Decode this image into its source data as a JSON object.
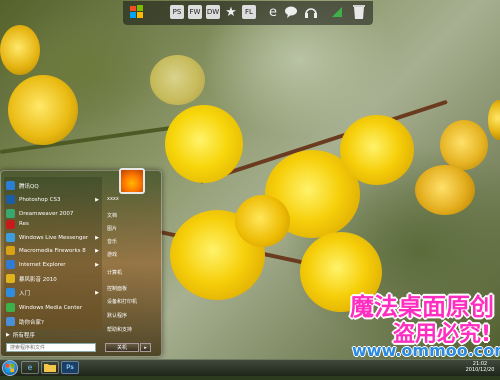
{
  "toolbar": {
    "icons": [
      {
        "name": "windows-logo-icon",
        "label": ""
      },
      {
        "name": "photoshop-icon",
        "label": "PS"
      },
      {
        "name": "fireworks-icon",
        "label": "FW"
      },
      {
        "name": "dreamweaver-icon",
        "label": "DW"
      },
      {
        "name": "star-icon",
        "label": "★"
      },
      {
        "name": "flash-icon",
        "label": "FL"
      },
      {
        "name": "ie-icon",
        "label": "e"
      },
      {
        "name": "chat-icon",
        "label": ""
      },
      {
        "name": "headphones-icon",
        "label": ""
      },
      {
        "name": "signal-icon",
        "label": ""
      },
      {
        "name": "recycle-bin-icon",
        "label": ""
      }
    ]
  },
  "start_menu": {
    "programs": [
      {
        "label": "腾讯QQ",
        "color": "#2a7fd4"
      },
      {
        "label": "Photoshop CS3",
        "color": "#1b5ea8"
      },
      {
        "label": "Dreamweaver 2007",
        "color": "#3aa86e"
      },
      {
        "label": "Res",
        "color": "#c91a1a"
      },
      {
        "label": "Windows Live Messenger",
        "color": "#3c9ee0"
      },
      {
        "label": "Macromedia Fireworks 8",
        "color": "#d8a214"
      },
      {
        "label": "Internet Explorer",
        "color": "#2f7bd6"
      },
      {
        "label": "暴风影音 2010",
        "color": "#e0b31c"
      },
      {
        "label": "入门",
        "color": "#2f8de0"
      },
      {
        "label": "Windows Media Center",
        "color": "#3cb14a"
      },
      {
        "label": "助你合家?",
        "color": "#4a8fd8"
      }
    ],
    "program_arrows": [
      false,
      true,
      false,
      false,
      true,
      true,
      true,
      false,
      true,
      false,
      false
    ],
    "all_programs": "所有程序",
    "right_items": [
      "xxxx",
      "文档",
      "图片",
      "音乐",
      "游戏",
      "计算机",
      "控制面板",
      "设备和打印机",
      "默认程序",
      "帮助和支持"
    ],
    "search_placeholder": "搜索程序和文件",
    "shutdown_label": "关机",
    "shutdown_arrow": "▸"
  },
  "watermark": {
    "line1": "魔法桌面原创",
    "line2": "盗用必究!",
    "line3": "www.ommoo.com"
  },
  "taskbar": {
    "buttons": [
      "ie",
      "folder",
      "Ps"
    ],
    "clock_time": "21:02",
    "clock_date": "2010/12/20"
  }
}
